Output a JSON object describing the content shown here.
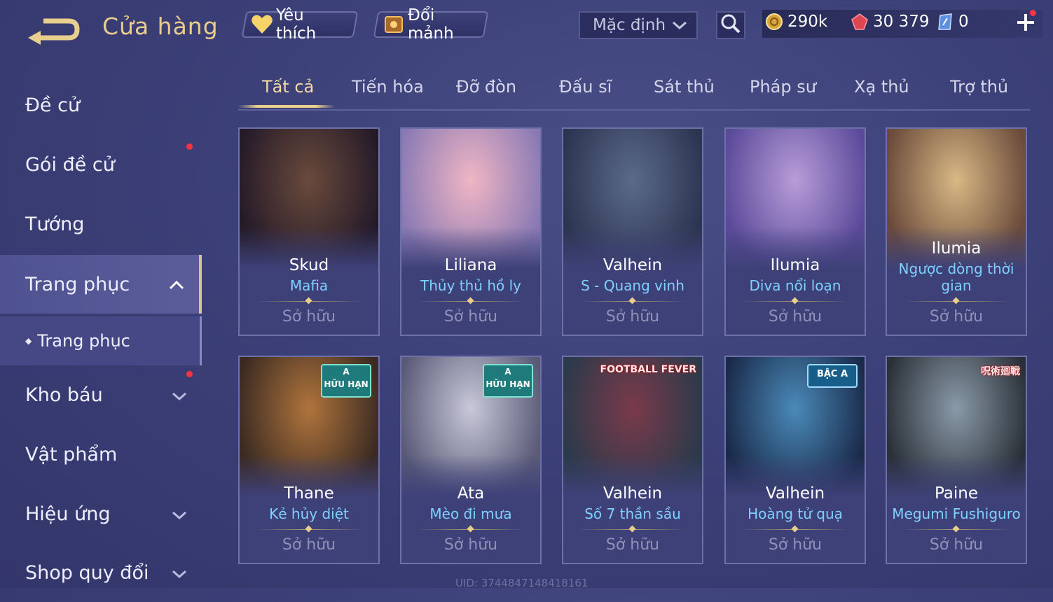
{
  "header": {
    "title": "Cửa hàng",
    "favorite_label": "Yêu thích",
    "exchange_label": "Đổi mảnh",
    "sort_value": "Mặc định",
    "currencies": {
      "gold": "290k",
      "ruby": "30 379",
      "voucher": "0"
    }
  },
  "sidebar": {
    "items": [
      {
        "label": "Đề cử"
      },
      {
        "label": "Gói đề cử"
      },
      {
        "label": "Tướng"
      },
      {
        "label": "Trang phục"
      },
      {
        "label": "Trang phục"
      },
      {
        "label": "Kho báu"
      },
      {
        "label": "Vật phẩm"
      },
      {
        "label": "Hiệu ứng"
      },
      {
        "label": "Shop quy đổi"
      }
    ]
  },
  "tabs": [
    "Tất cả",
    "Tiến hóa",
    "Đỡ đòn",
    "Đấu sĩ",
    "Sát thủ",
    "Pháp sư",
    "Xạ thủ",
    "Trợ thủ"
  ],
  "cards": [
    {
      "hero": "Skud",
      "skin": "Mafia",
      "status": "Sở hữu",
      "art": [
        "#6a4a3c",
        "#241a28"
      ]
    },
    {
      "hero": "Liliana",
      "skin": "Thủy thủ hồ ly",
      "status": "Sở hữu",
      "art": [
        "#f0b6c4",
        "#8a7ab4"
      ]
    },
    {
      "hero": "Valhein",
      "skin": "S - Quang vinh",
      "status": "Sở hữu",
      "art": [
        "#5b6a8a",
        "#2c3550"
      ]
    },
    {
      "hero": "Ilumia",
      "skin": "Diva nổi loạn",
      "status": "Sở hữu",
      "art": [
        "#b89cd8",
        "#5a4a9a"
      ]
    },
    {
      "hero": "Ilumia",
      "skin": "Ngược dòng thời gian",
      "status": "Sở hữu",
      "art": [
        "#d8b884",
        "#6a4a3a"
      ]
    },
    {
      "hero": "Thane",
      "skin": "Kẻ hủy diệt",
      "status": "Sở hữu",
      "art": [
        "#b0743c",
        "#3a2a22"
      ],
      "badge": "A\nHỮU HẠN"
    },
    {
      "hero": "Ata",
      "skin": "Mèo đi mưa",
      "status": "Sở hữu",
      "art": [
        "#c8c8d8",
        "#5a5a78"
      ],
      "badge": "A\nHỮU HẠN"
    },
    {
      "hero": "Valhein",
      "skin": "Số 7 thần sầu",
      "status": "Sở hữu",
      "art": [
        "#7a3a4a",
        "#2a3a4a"
      ],
      "badge_text": "FOOTBALL FEVER"
    },
    {
      "hero": "Valhein",
      "skin": "Hoàng tử quạ",
      "status": "Sở hữu",
      "art": [
        "#4a8ab8",
        "#1a2a4a"
      ],
      "badge": "BẬC A"
    },
    {
      "hero": "Paine",
      "skin": "Megumi Fushiguro",
      "status": "Sở hữu",
      "art": [
        "#8a9aa8",
        "#2a3038"
      ],
      "badge_text": "呪術廻戦"
    }
  ],
  "uid_text": "UID: 3744847148418161",
  "colors": {
    "accent_gold": "#e9cd8b",
    "skin_name": "#7fd0ff",
    "notification": "#ff3344"
  }
}
